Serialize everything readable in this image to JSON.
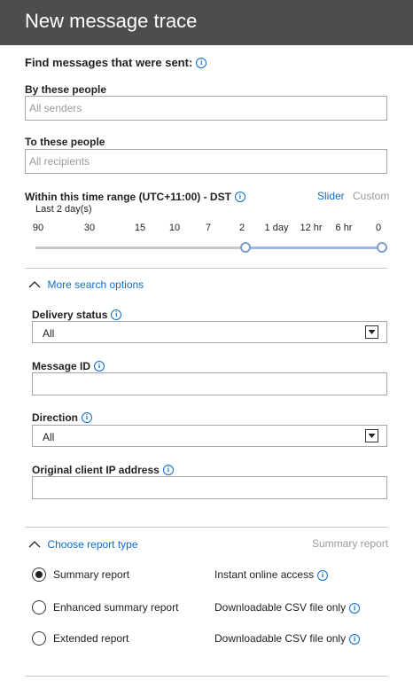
{
  "header": {
    "title": "New message trace"
  },
  "find": {
    "title": "Find messages that were sent:"
  },
  "senders": {
    "label": "By these people",
    "placeholder": "All senders"
  },
  "recipients": {
    "label": "To these people",
    "placeholder": "All recipients"
  },
  "time_range": {
    "label": "Within this time range (UTC+11:00) - DST",
    "modes": [
      "Slider",
      "Custom"
    ],
    "active_mode": "Slider",
    "selected_text": "Last 2 day(s)",
    "ticks": [
      "90",
      "30",
      "15",
      "10",
      "7",
      "2",
      "1 day",
      "12 hr",
      "6 hr",
      "0"
    ],
    "selected_start": "2",
    "selected_end": "0"
  },
  "more_options": {
    "label": "More search options"
  },
  "delivery_status": {
    "label": "Delivery status",
    "value": "All"
  },
  "message_id": {
    "label": "Message ID",
    "value": ""
  },
  "direction": {
    "label": "Direction",
    "value": "All"
  },
  "client_ip": {
    "label": "Original client IP address",
    "value": ""
  },
  "report_type": {
    "label": "Choose report type",
    "current": "Summary report",
    "options": [
      {
        "label": "Summary report",
        "desc": "Instant online access",
        "checked": true
      },
      {
        "label": "Enhanced summary report",
        "desc": "Downloadable CSV file only",
        "checked": false
      },
      {
        "label": "Extended report",
        "desc": "Downloadable CSV file only",
        "checked": false
      }
    ]
  },
  "colors": {
    "accent": "#0a6ed1",
    "header_bg": "#4d4d4d"
  },
  "icons": {
    "info": "info-icon",
    "chevron_up": "chevron-up-icon",
    "dropdown": "chevron-down-icon"
  }
}
